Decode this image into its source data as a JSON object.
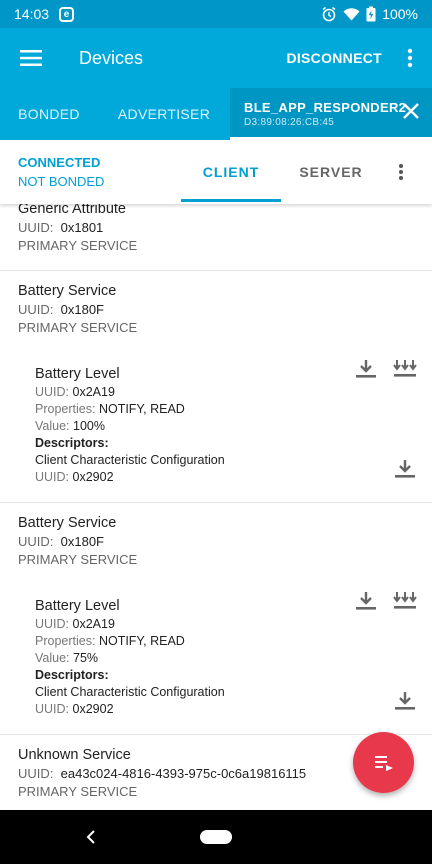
{
  "status_bar": {
    "time": "14:03",
    "notification_glyph": "e",
    "battery": "100%"
  },
  "app_bar": {
    "title": "Devices",
    "disconnect_label": "DISCONNECT"
  },
  "device_tabs": {
    "bonded": "BONDED",
    "advertiser": "ADVERTISER",
    "active_name": "BLE_APP_RESPONDER2",
    "active_address": "D3:89:08:26:CB:45"
  },
  "connection": {
    "status": "CONNECTED",
    "bond": "NOT BONDED",
    "client_tab": "CLIENT",
    "server_tab": "SERVER"
  },
  "labels": {
    "uuid": "UUID:",
    "properties": "Properties:",
    "value": "Value:",
    "descriptors": "Descriptors:"
  },
  "services": [
    {
      "name": "Generic Attribute",
      "uuid": "0x1801",
      "type": "PRIMARY SERVICE"
    },
    {
      "name": "Battery Service",
      "uuid": "0x180F",
      "type": "PRIMARY SERVICE",
      "characteristic": {
        "name": "Battery Level",
        "uuid": "0x2A19",
        "properties": "NOTIFY, READ",
        "value": "100%",
        "descriptor_name": "Client Characteristic Configuration",
        "descriptor_uuid": "0x2902"
      }
    },
    {
      "name": "Battery Service",
      "uuid": "0x180F",
      "type": "PRIMARY SERVICE",
      "characteristic": {
        "name": "Battery Level",
        "uuid": "0x2A19",
        "properties": "NOTIFY, READ",
        "value": "75%",
        "descriptor_name": "Client Characteristic Configuration",
        "descriptor_uuid": "0x2902"
      }
    },
    {
      "name": "Unknown Service",
      "uuid": "ea43c024-4816-4393-975c-0c6a19816115",
      "type": "PRIMARY SERVICE"
    }
  ],
  "colors": {
    "primary": "#00a9d9",
    "accent": "#00a0d2",
    "fab": "#e8384c"
  }
}
